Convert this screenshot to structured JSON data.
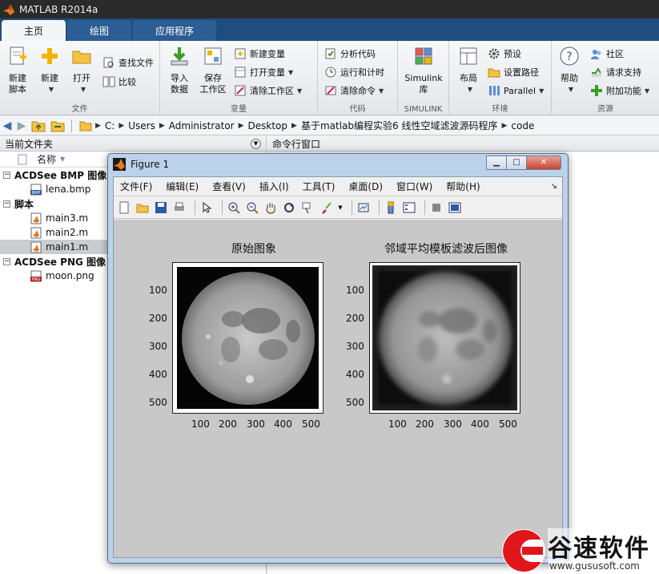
{
  "window": {
    "title": "MATLAB R2014a"
  },
  "ribbon_tabs": [
    "主页",
    "绘图",
    "应用程序"
  ],
  "ribbon": {
    "file_group": {
      "label": "文件",
      "new_script": "新建\n脚本",
      "new": "新建",
      "open": "打开",
      "find_files": "查找文件",
      "compare": "比较"
    },
    "variable_group": {
      "label": "变量",
      "import": "导入\n数据",
      "save": "保存\n工作区",
      "new_var": "新建变量",
      "open_var": "打开变量",
      "clear_ws": "清除工作区"
    },
    "code_group": {
      "label": "代码",
      "analyze": "分析代码",
      "run_time": "运行和计时",
      "clear_cmd": "清除命令"
    },
    "simulink_group": {
      "label": "SIMULINK",
      "simulink": "Simulink\n库"
    },
    "env_group": {
      "label": "环境",
      "layout": "布局",
      "prefs": "预设",
      "set_path": "设置路径",
      "parallel": "Parallel"
    },
    "resources_group": {
      "label": "资源",
      "help": "帮助",
      "community": "社区",
      "request_support": "请求支持",
      "addons": "附加功能"
    }
  },
  "address": {
    "path": [
      "C:",
      "Users",
      "Administrator",
      "Desktop",
      "基于matlab编程实验6  线性空域滤波源码程序",
      "code"
    ]
  },
  "current_folder": {
    "title": "当前文件夹",
    "column_name": "名称",
    "groups": [
      {
        "name": "ACDSee BMP 图像",
        "items": [
          {
            "name": "lena.bmp",
            "icon": "bmp-file-icon",
            "selected": false
          }
        ]
      },
      {
        "name": "脚本",
        "items": [
          {
            "name": "main3.m",
            "icon": "m-file-icon",
            "selected": false
          },
          {
            "name": "main2.m",
            "icon": "m-file-icon",
            "selected": false
          },
          {
            "name": "main1.m",
            "icon": "m-file-icon",
            "selected": true
          }
        ]
      },
      {
        "name": "ACDSee PNG 图像",
        "items": [
          {
            "name": "moon.png",
            "icon": "png-file-icon",
            "selected": false
          }
        ]
      }
    ]
  },
  "command_window": {
    "title": "命令行窗口"
  },
  "figure": {
    "title": "Figure 1",
    "menu": [
      "文件(F)",
      "编辑(E)",
      "查看(V)",
      "插入(I)",
      "工具(T)",
      "桌面(D)",
      "窗口(W)",
      "帮助(H)"
    ],
    "axes": [
      {
        "title": "原始图象",
        "yticks": [
          "100",
          "200",
          "300",
          "400",
          "500"
        ],
        "xticks": [
          "100",
          "200",
          "300",
          "400",
          "500"
        ],
        "image": "moon-sharp"
      },
      {
        "title": "邻域平均模板滤波后图像",
        "yticks": [
          "100",
          "200",
          "300",
          "400",
          "500"
        ],
        "xticks": [
          "100",
          "200",
          "300",
          "400",
          "500"
        ],
        "image": "moon-blurred"
      }
    ]
  },
  "watermark": {
    "brand": "谷速软件",
    "url": "www.gususoft.com"
  },
  "colors": {
    "ribbon_tab_bar": "#1f4d7f",
    "title_bar": "#2a2a2a",
    "figure_canvas": "#c8c8c8"
  }
}
